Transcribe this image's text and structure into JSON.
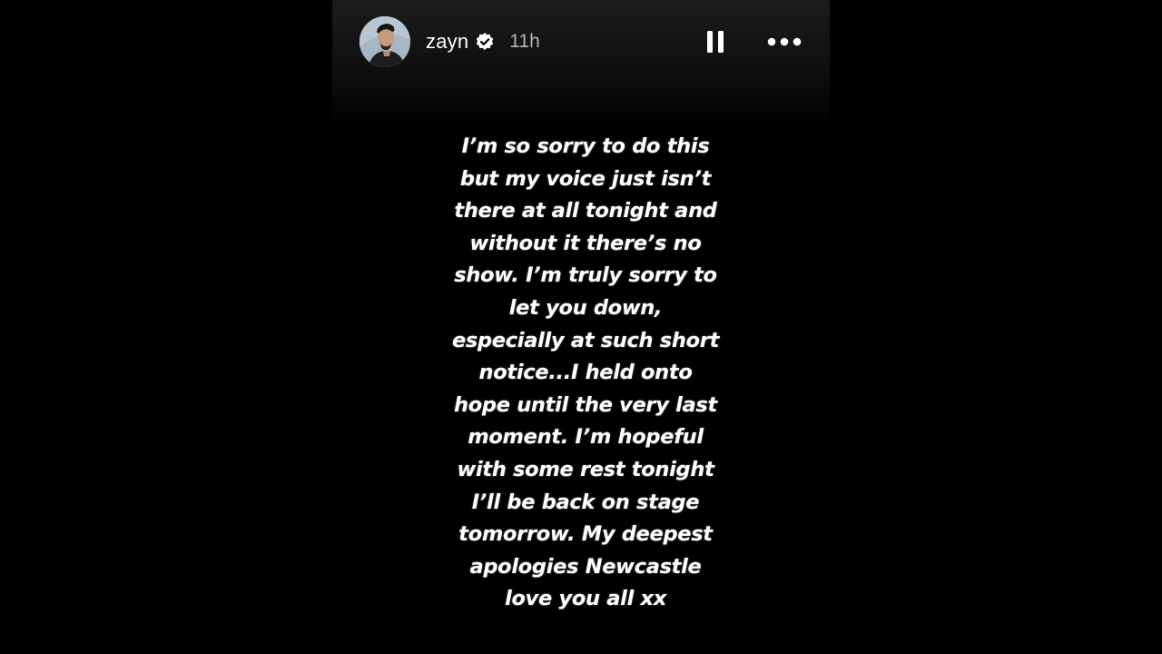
{
  "story": {
    "user": {
      "username": "zayn",
      "verified": true,
      "avatar_icon": "profile-photo",
      "verified_icon": "verified-badge-icon"
    },
    "timestamp": "11h",
    "controls": {
      "pause_icon": "pause-icon",
      "more_icon": "more-options-icon"
    },
    "message": "I’m so sorry to do this\nbut my voice just isn’t\nthere at all tonight and\nwithout it there’s no\nshow. I’m truly sorry to\nlet you down,\nespecially at such short\nnotice...I held onto\nhope until the very last\nmoment. I’m hopeful\nwith some rest tonight\nI’ll be back on stage\ntomorrow. My deepest\napologies Newcastle\nlove you all xx"
  },
  "colors": {
    "page_background": "#000000",
    "header_gradient_top": "#1c1c1c",
    "text": "#ffffff",
    "timestamp_text": "#b4b4b4"
  }
}
